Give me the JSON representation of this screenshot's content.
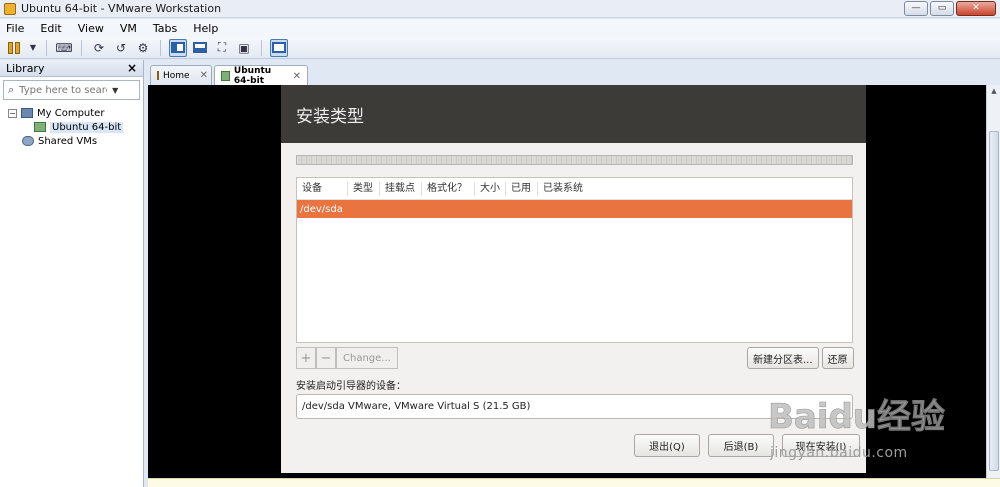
{
  "window": {
    "title": "Ubuntu 64-bit - VMware Workstation",
    "controls": {
      "minimize": "—",
      "maximize": "▭",
      "close": "✕"
    }
  },
  "menu": [
    "File",
    "Edit",
    "View",
    "VM",
    "Tabs",
    "Help"
  ],
  "toolbar": {
    "icons": [
      "pause-icon",
      "dropdown-arrow-icon",
      "send-keys-icon",
      "snapshot-take-icon",
      "snapshot-revert-icon",
      "snapshot-manager-icon",
      "library-view-icon",
      "thumbnail-bar-icon",
      "fullscreen-icon",
      "unity-icon",
      "console-view-icon"
    ]
  },
  "library": {
    "title": "Library",
    "search_placeholder": "Type here to search",
    "tree": {
      "root": "My Computer",
      "child": "Ubuntu 64-bit",
      "shared": "Shared VMs"
    }
  },
  "tabs": [
    {
      "label": "Home",
      "active": false
    },
    {
      "label": "Ubuntu 64-bit",
      "active": true
    }
  ],
  "installer": {
    "header": "安装类型",
    "columns": [
      "设备",
      "类型",
      "挂载点",
      "格式化？",
      "大小",
      "已用",
      "已装系统"
    ],
    "selected_row": "/dev/sda",
    "add_label": "+",
    "remove_label": "−",
    "change_label": "Change...",
    "new_table_label": "新建分区表...",
    "revert_label": "还原",
    "boot_loader_label": "安装启动引导器的设备：",
    "boot_device": "/dev/sda  VMware, VMware Virtual S (21.5 GB)",
    "quit_label": "退出(Q)",
    "back_label": "后退(B)",
    "install_now_label": "现在安装(I)",
    "accent_color": "#e9743f"
  },
  "watermark": {
    "brand": "Baidu经验",
    "url": "jingyan.baidu.com"
  }
}
